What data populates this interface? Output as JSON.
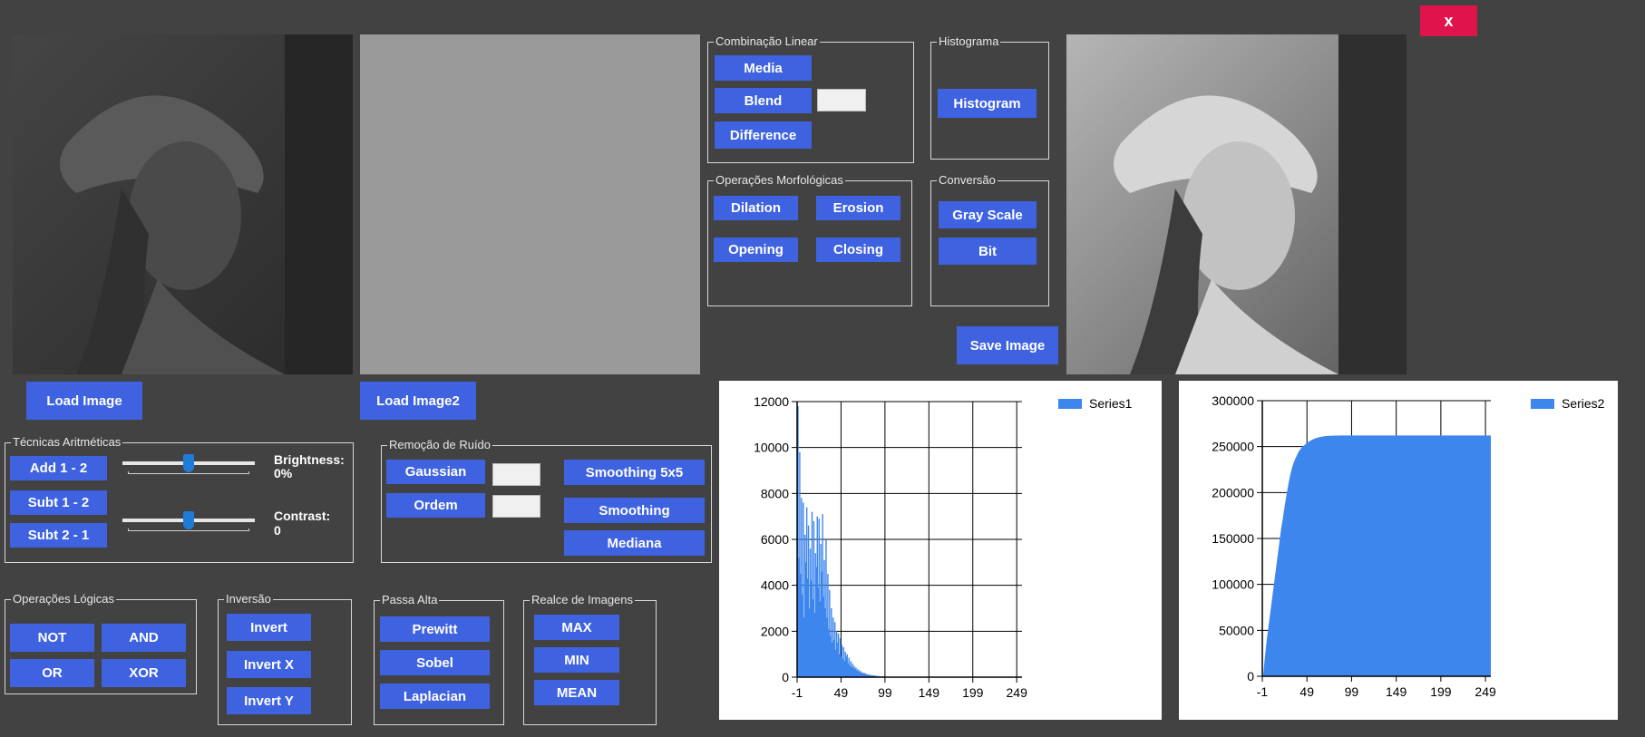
{
  "window": {
    "close_label": "x"
  },
  "images": {
    "image1_alt": "Grayscale portrait (dim)",
    "image3_alt": "Grayscale portrait (enhanced)"
  },
  "buttons": {
    "load_image": "Load Image",
    "load_image2": "Load Image2",
    "save_image": "Save Image"
  },
  "combinacao_linear": {
    "title": "Combinação Linear",
    "media": "Media",
    "blend": "Blend",
    "difference": "Difference",
    "blend_value": ""
  },
  "histograma": {
    "title": "Histograma",
    "histogram": "Histogram"
  },
  "operacoes_morfologicas": {
    "title": "Operações Morfológicas",
    "dilation": "Dilation",
    "erosion": "Erosion",
    "opening": "Opening",
    "closing": "Closing"
  },
  "conversao": {
    "title": "Conversão",
    "gray_scale": "Gray Scale",
    "bit": "Bit"
  },
  "tecnicas_aritmeticas": {
    "title": "Técnicas Aritméticas",
    "add": "Add 1 - 2",
    "subt12": "Subt 1 - 2",
    "subt21": "Subt 2 - 1",
    "brightness_label": "Brightness:",
    "brightness_value": "0%",
    "contrast_label": "Contrast:",
    "contrast_value": "0",
    "brightness_level": 0.5,
    "contrast_level": 0.5
  },
  "remocao_ruido": {
    "title": "Remoção de Ruído",
    "gaussian": "Gaussian",
    "ordem": "Ordem",
    "smoothing5x5": "Smoothing 5x5",
    "smoothing": "Smoothing",
    "mediana": "Mediana",
    "gaussian_value": "",
    "ordem_value": ""
  },
  "operacoes_logicas": {
    "title": "Operações Lógicas",
    "not": "NOT",
    "and": "AND",
    "or": "OR",
    "xor": "XOR"
  },
  "inversao": {
    "title": "Inversão",
    "invert": "Invert",
    "invert_x": "Invert X",
    "invert_y": "Invert Y"
  },
  "passa_alta": {
    "title": "Passa Alta",
    "prewitt": "Prewitt",
    "sobel": "Sobel",
    "laplacian": "Laplacian"
  },
  "realce": {
    "title": "Realce de Imagens",
    "max": "MAX",
    "min": "MIN",
    "mean": "MEAN"
  },
  "colors": {
    "accent": "#3f63e0",
    "background": "#424242",
    "close": "#e0144c",
    "series": "#3d86ee"
  },
  "chart_data": [
    {
      "type": "bar",
      "legend": "Series1",
      "x_ticks": [
        "-1",
        "49",
        "99",
        "149",
        "199",
        "249"
      ],
      "y_ticks": [
        "0",
        "2000",
        "4000",
        "6000",
        "8000",
        "10000",
        "12000"
      ],
      "xlim": [
        -1,
        255
      ],
      "ylim": [
        0,
        12000
      ],
      "points": [
        [
          0,
          11800
        ],
        [
          1,
          5200
        ],
        [
          2,
          9800
        ],
        [
          3,
          4500
        ],
        [
          4,
          7800
        ],
        [
          5,
          3600
        ],
        [
          6,
          7600
        ],
        [
          7,
          2600
        ],
        [
          8,
          6200
        ],
        [
          9,
          5000
        ],
        [
          10,
          7400
        ],
        [
          11,
          4300
        ],
        [
          12,
          6600
        ],
        [
          13,
          3000
        ],
        [
          14,
          5600
        ],
        [
          15,
          4200
        ],
        [
          16,
          7200
        ],
        [
          17,
          3400
        ],
        [
          18,
          6800
        ],
        [
          19,
          2800
        ],
        [
          20,
          5400
        ],
        [
          21,
          4800
        ],
        [
          22,
          7000
        ],
        [
          23,
          3900
        ],
        [
          24,
          6900
        ],
        [
          25,
          3300
        ],
        [
          26,
          5800
        ],
        [
          27,
          4600
        ],
        [
          28,
          7100
        ],
        [
          29,
          3500
        ],
        [
          30,
          5100
        ],
        [
          31,
          3000
        ],
        [
          32,
          6000
        ],
        [
          33,
          2600
        ],
        [
          34,
          4500
        ],
        [
          35,
          2100
        ],
        [
          36,
          3800
        ],
        [
          37,
          1800
        ],
        [
          38,
          3000
        ],
        [
          39,
          1500
        ],
        [
          40,
          2600
        ],
        [
          41,
          1600
        ],
        [
          42,
          2400
        ],
        [
          43,
          1200
        ],
        [
          44,
          2000
        ],
        [
          45,
          1500
        ],
        [
          46,
          1900
        ],
        [
          47,
          1000
        ],
        [
          48,
          1700
        ],
        [
          49,
          900
        ],
        [
          50,
          1400
        ],
        [
          51,
          800
        ],
        [
          52,
          1300
        ],
        [
          53,
          700
        ],
        [
          54,
          1100
        ],
        [
          55,
          900
        ],
        [
          56,
          1000
        ],
        [
          57,
          600
        ],
        [
          58,
          850
        ],
        [
          59,
          500
        ],
        [
          60,
          700
        ],
        [
          61,
          450
        ],
        [
          62,
          600
        ],
        [
          63,
          400
        ],
        [
          64,
          500
        ],
        [
          65,
          350
        ],
        [
          66,
          420
        ],
        [
          67,
          300
        ],
        [
          68,
          350
        ],
        [
          69,
          250
        ],
        [
          70,
          300
        ],
        [
          71,
          200
        ],
        [
          72,
          250
        ],
        [
          73,
          160
        ],
        [
          74,
          200
        ],
        [
          75,
          150
        ],
        [
          76,
          180
        ],
        [
          77,
          120
        ],
        [
          78,
          150
        ],
        [
          79,
          100
        ],
        [
          80,
          120
        ],
        [
          81,
          90
        ],
        [
          82,
          100
        ],
        [
          83,
          80
        ],
        [
          84,
          90
        ],
        [
          85,
          70
        ],
        [
          86,
          80
        ],
        [
          87,
          60
        ],
        [
          88,
          70
        ],
        [
          89,
          50
        ],
        [
          90,
          60
        ],
        [
          92,
          45
        ],
        [
          94,
          40
        ],
        [
          96,
          35
        ],
        [
          98,
          30
        ],
        [
          100,
          25
        ],
        [
          104,
          20
        ],
        [
          108,
          15
        ],
        [
          112,
          12
        ],
        [
          116,
          10
        ],
        [
          120,
          8
        ],
        [
          126,
          6
        ],
        [
          132,
          5
        ],
        [
          140,
          4
        ],
        [
          150,
          3
        ]
      ]
    },
    {
      "type": "area",
      "legend": "Series2",
      "x_ticks": [
        "-1",
        "49",
        "99",
        "149",
        "199",
        "249"
      ],
      "y_ticks": [
        "0",
        "50000",
        "100000",
        "150000",
        "200000",
        "250000",
        "300000"
      ],
      "xlim": [
        -1,
        255
      ],
      "ylim": [
        0,
        300000
      ],
      "points": [
        [
          0,
          0
        ],
        [
          1,
          12000
        ],
        [
          2,
          22000
        ],
        [
          4,
          40000
        ],
        [
          6,
          55000
        ],
        [
          8,
          70000
        ],
        [
          10,
          85000
        ],
        [
          12,
          100000
        ],
        [
          14,
          115000
        ],
        [
          16,
          130000
        ],
        [
          18,
          145000
        ],
        [
          20,
          160000
        ],
        [
          22,
          172000
        ],
        [
          24,
          185000
        ],
        [
          26,
          197000
        ],
        [
          28,
          208000
        ],
        [
          30,
          218000
        ],
        [
          32,
          226000
        ],
        [
          34,
          232000
        ],
        [
          36,
          237000
        ],
        [
          38,
          241000
        ],
        [
          40,
          245000
        ],
        [
          44,
          250000
        ],
        [
          48,
          253000
        ],
        [
          52,
          256000
        ],
        [
          56,
          258000
        ],
        [
          60,
          259500
        ],
        [
          64,
          260500
        ],
        [
          70,
          261500
        ],
        [
          80,
          262000
        ],
        [
          90,
          262144
        ],
        [
          100,
          262144
        ],
        [
          150,
          262144
        ],
        [
          200,
          262144
        ],
        [
          255,
          262144
        ]
      ]
    }
  ]
}
